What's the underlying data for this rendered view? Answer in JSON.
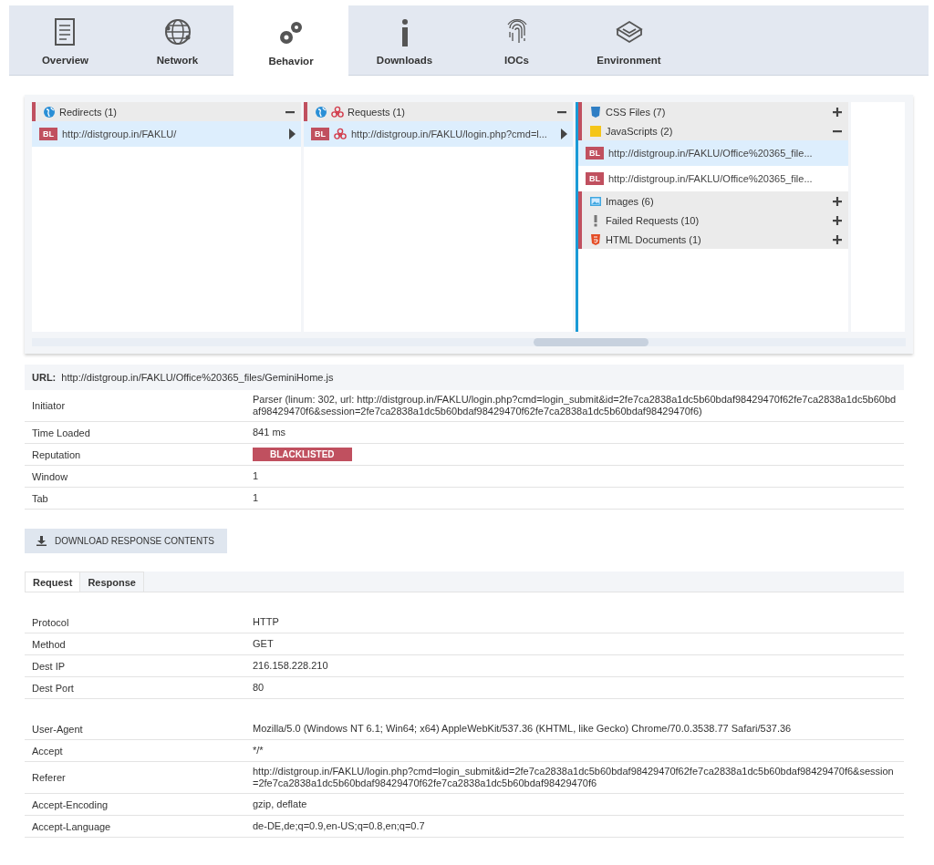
{
  "tabs": [
    {
      "label": "Overview",
      "kind": "document",
      "selected": false
    },
    {
      "label": "Network",
      "kind": "globe",
      "selected": false
    },
    {
      "label": "Behavior",
      "kind": "gears",
      "selected": true
    },
    {
      "label": "Downloads",
      "kind": "info",
      "selected": false
    },
    {
      "label": "IOCs",
      "kind": "fingerprint",
      "selected": false
    },
    {
      "label": "Environment",
      "kind": "cube",
      "selected": false
    }
  ],
  "columns": [
    {
      "groups": [
        {
          "title": "Redirects (1)",
          "kind": "globe",
          "malicious": false,
          "expanded": true,
          "items": [
            {
              "badge": "BL",
              "url": "http://distgroup.in/FAKLU/",
              "malicious": false,
              "selected": true,
              "expandable": true
            }
          ]
        }
      ]
    },
    {
      "groups": [
        {
          "title": "Requests (1)",
          "kind": "globe",
          "malicious": true,
          "expanded": true,
          "items": [
            {
              "badge": "BL",
              "url": "http://distgroup.in/FAKLU/login.php?cmd=l...",
              "malicious": true,
              "selected": true,
              "expandable": true
            }
          ]
        }
      ]
    },
    {
      "groups": [
        {
          "title": "CSS Files (7)",
          "kind": "css",
          "malicious": false,
          "expanded": false
        },
        {
          "title": "JavaScripts (2)",
          "kind": "js",
          "malicious": false,
          "expanded": true,
          "items": [
            {
              "badge": "BL",
              "url": "http://distgroup.in/FAKLU/Office%20365_file...",
              "malicious": false,
              "selected": true,
              "expandable": false
            },
            {
              "badge": "BL",
              "url": "http://distgroup.in/FAKLU/Office%20365_file...",
              "malicious": false,
              "selected": false,
              "expandable": false
            }
          ]
        },
        {
          "title": "Images (6)",
          "kind": "image",
          "malicious": false,
          "expanded": false
        },
        {
          "title": "Failed Requests (10)",
          "kind": "failed",
          "malicious": false,
          "expanded": false
        },
        {
          "title": "HTML Documents (1)",
          "kind": "html",
          "malicious": false,
          "expanded": false
        }
      ]
    }
  ],
  "details": {
    "url_label": "URL:",
    "url": "http://distgroup.in/FAKLU/Office%20365_files/GeminiHome.js",
    "rows": [
      {
        "label": "Initiator",
        "value": "Parser (linum: 302, url: http://distgroup.in/FAKLU/login.php?cmd=login_submit&id=2fe7ca2838a1dc5b60bdaf98429470f62fe7ca2838a1dc5b60bdaf98429470f6&session=2fe7ca2838a1dc5b60bdaf98429470f62fe7ca2838a1dc5b60bdaf98429470f6)",
        "kind": "text"
      },
      {
        "label": "Time Loaded",
        "value": "841 ms",
        "kind": "text"
      },
      {
        "label": "Reputation",
        "value": "BLACKLISTED",
        "kind": "badge"
      },
      {
        "label": "Window",
        "value": "1",
        "kind": "text"
      },
      {
        "label": "Tab",
        "value": "1",
        "kind": "text"
      }
    ]
  },
  "download_button": "DOWNLOAD RESPONSE CONTENTS",
  "sub_tabs": [
    {
      "label": "Request",
      "selected": true
    },
    {
      "label": "Response",
      "selected": false
    }
  ],
  "request_sections": [
    {
      "rows": [
        {
          "label": "Protocol",
          "value": "HTTP"
        },
        {
          "label": "Method",
          "value": "GET"
        },
        {
          "label": "Dest IP",
          "value": "216.158.228.210"
        },
        {
          "label": "Dest Port",
          "value": "80"
        }
      ]
    },
    {
      "rows": [
        {
          "label": "User-Agent",
          "value": "Mozilla/5.0 (Windows NT 6.1; Win64; x64) AppleWebKit/537.36 (KHTML, like Gecko) Chrome/70.0.3538.77 Safari/537.36"
        },
        {
          "label": "Accept",
          "value": "*/*"
        },
        {
          "label": "Referer",
          "value": "http://distgroup.in/FAKLU/login.php?cmd=login_submit&id=2fe7ca2838a1dc5b60bdaf98429470f62fe7ca2838a1dc5b60bdaf98429470f6&session=2fe7ca2838a1dc5b60bdaf98429470f62fe7ca2838a1dc5b60bdaf98429470f6"
        },
        {
          "label": "Accept-Encoding",
          "value": "gzip, deflate"
        },
        {
          "label": "Accept-Language",
          "value": "de-DE,de;q=0.9,en-US;q=0.8,en;q=0.7"
        }
      ]
    }
  ]
}
